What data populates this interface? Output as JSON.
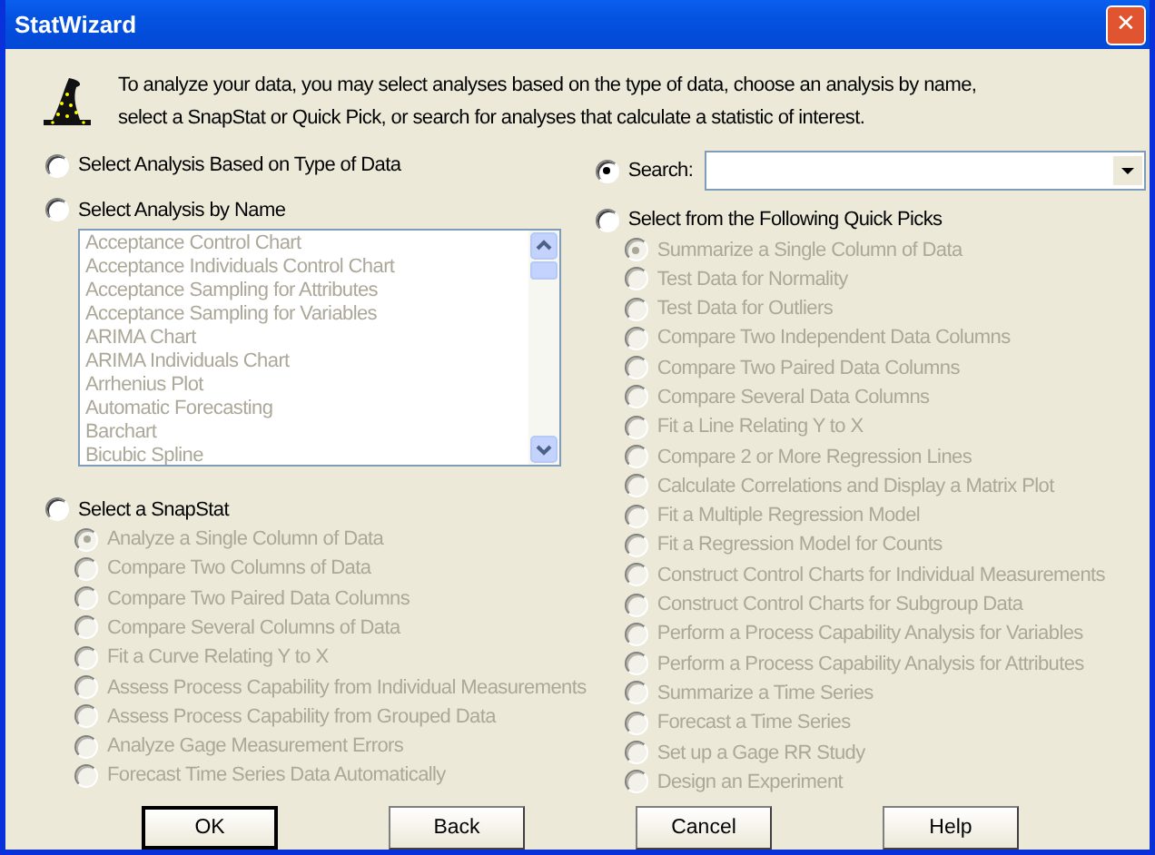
{
  "window": {
    "title": "StatWizard",
    "close_symbol": "✕"
  },
  "intro_lines": [
    "To analyze your data, you may select analyses based on the type of data, choose an analysis by name,",
    "select a SnapStat or Quick Pick, or search for analyses that calculate a statistic of interest."
  ],
  "type_option": {
    "label": "Select Analysis Based on Type of Data",
    "selected": false
  },
  "name_option": {
    "label": "Select Analysis by Name",
    "selected": false
  },
  "analysis_list": {
    "disabled": true,
    "items": [
      "Acceptance Control Chart",
      "Acceptance Individuals Control Chart",
      "Acceptance Sampling for Attributes",
      "Acceptance Sampling for Variables",
      "ARIMA Chart",
      "ARIMA Individuals Chart",
      "Arrhenius Plot",
      "Automatic Forecasting",
      "Barchart",
      "Bicubic Spline"
    ]
  },
  "snapstat_option": {
    "label": "Select a SnapStat",
    "selected": false
  },
  "snapstats": [
    {
      "label": "Analyze a Single Column of Data",
      "selected": true,
      "disabled": true
    },
    {
      "label": "Compare Two Columns of Data",
      "selected": false,
      "disabled": true
    },
    {
      "label": "Compare Two Paired Data Columns",
      "selected": false,
      "disabled": true
    },
    {
      "label": "Compare Several Columns of Data",
      "selected": false,
      "disabled": true
    },
    {
      "label": "Fit a Curve Relating Y to X",
      "selected": false,
      "disabled": true
    },
    {
      "label": "Assess Process Capability from Individual Measurements",
      "selected": false,
      "disabled": true
    },
    {
      "label": "Assess Process Capability from Grouped Data",
      "selected": false,
      "disabled": true
    },
    {
      "label": "Analyze Gage Measurement Errors",
      "selected": false,
      "disabled": true
    },
    {
      "label": "Forecast Time Series Data Automatically",
      "selected": false,
      "disabled": true
    }
  ],
  "search_option": {
    "label": "Search:",
    "selected": true
  },
  "quickpicks_option": {
    "label": "Select from the Following Quick Picks",
    "selected": false
  },
  "quick_picks": [
    {
      "label": "Summarize a Single Column of Data",
      "selected": true,
      "disabled": true
    },
    {
      "label": "Test Data for Normality",
      "selected": false,
      "disabled": true
    },
    {
      "label": "Test Data for Outliers",
      "selected": false,
      "disabled": true
    },
    {
      "label": "Compare Two Independent Data Columns",
      "selected": false,
      "disabled": true
    },
    {
      "label": "Compare Two Paired Data Columns",
      "selected": false,
      "disabled": true
    },
    {
      "label": "Compare Several Data Columns",
      "selected": false,
      "disabled": true
    },
    {
      "label": "Fit a Line Relating Y to X",
      "selected": false,
      "disabled": true
    },
    {
      "label": "Compare 2 or More Regression Lines",
      "selected": false,
      "disabled": true
    },
    {
      "label": "Calculate Correlations and Display a Matrix Plot",
      "selected": false,
      "disabled": true
    },
    {
      "label": "Fit a Multiple Regression Model",
      "selected": false,
      "disabled": true
    },
    {
      "label": "Fit a Regression Model for Counts",
      "selected": false,
      "disabled": true
    },
    {
      "label": "Construct Control Charts for Individual Measurements",
      "selected": false,
      "disabled": true
    },
    {
      "label": "Construct Control Charts for Subgroup Data",
      "selected": false,
      "disabled": true
    },
    {
      "label": "Perform a Process Capability Analysis for Variables",
      "selected": false,
      "disabled": true
    },
    {
      "label": "Perform a Process Capability Analysis for Attributes",
      "selected": false,
      "disabled": true
    },
    {
      "label": "Summarize a Time Series",
      "selected": false,
      "disabled": true
    },
    {
      "label": "Forecast a Time Series",
      "selected": false,
      "disabled": true
    },
    {
      "label": "Set up a Gage RR Study",
      "selected": false,
      "disabled": true
    },
    {
      "label": "Design an Experiment",
      "selected": false,
      "disabled": true
    }
  ],
  "buttons": [
    {
      "label": "OK",
      "default": true
    },
    {
      "label": "Back",
      "default": false
    },
    {
      "label": "Cancel",
      "default": false
    },
    {
      "label": "Help",
      "default": false
    }
  ]
}
